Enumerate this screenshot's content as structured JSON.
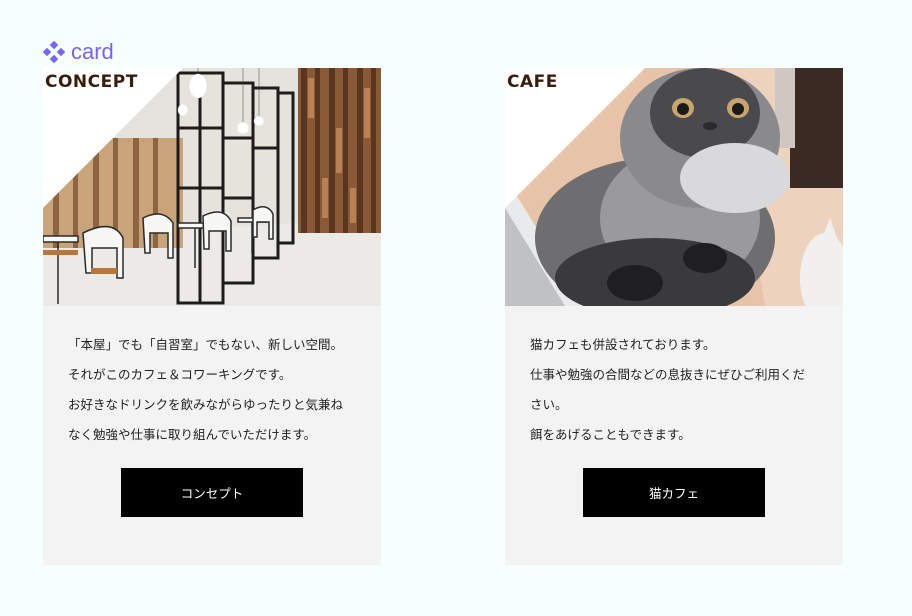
{
  "frame": {
    "label": "card",
    "icon": "component-icon",
    "color": "#7b61ff"
  },
  "cards": [
    {
      "title": "CONCEPT",
      "image": "cafe-interior-image",
      "lines": [
        "「本屋」でも「自習室」でもない、新しい空間。",
        "それがこのカフェ＆コワーキングです。",
        "お好きなドリンクを飲みながらゆったりと気兼ね",
        "なく勉強や仕事に取り組んでいただけます。"
      ],
      "button": "コンセプト"
    },
    {
      "title": "CAFE",
      "image": "cat-photo-image",
      "lines": [
        "猫カフェも併設されております。",
        "仕事や勉強の合間などの息抜きにぜひご利用くだ",
        "さい。",
        "餌をあげることもできます。"
      ],
      "button": "猫カフェ"
    }
  ],
  "colors": {
    "background": "#f5fffe",
    "card_bg": "#f4f3f3",
    "title": "#3a1d0a",
    "button_bg": "#000000",
    "button_text": "#ffffff"
  }
}
